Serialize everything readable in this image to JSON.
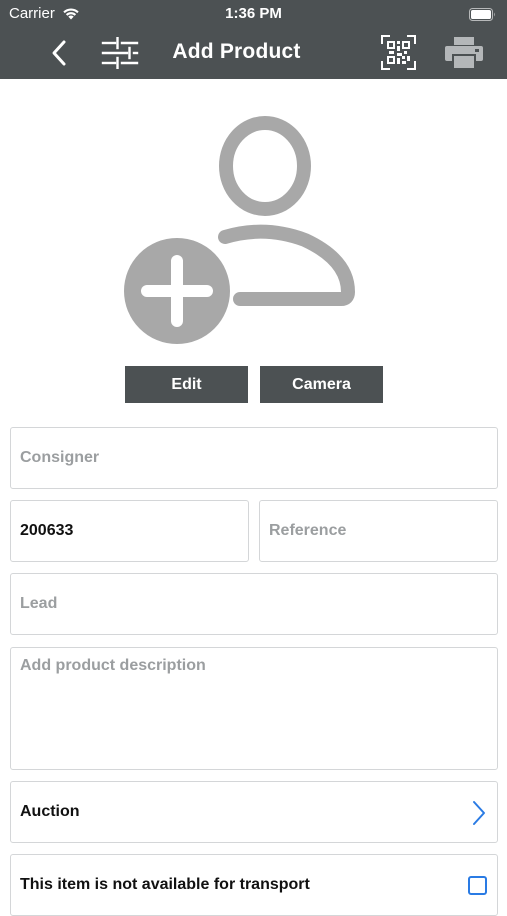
{
  "status_bar": {
    "carrier": "Carrier",
    "time": "1:36 PM"
  },
  "nav": {
    "title": "Add Product",
    "icons": [
      "back-chevron-icon",
      "filter-sliders-icon",
      "qr-code-icon",
      "printer-icon"
    ]
  },
  "photo": {
    "edit_label": "Edit",
    "camera_label": "Camera"
  },
  "form": {
    "consigner_placeholder": "Consigner",
    "number_value": "200633",
    "reference_placeholder": "Reference",
    "lead_placeholder": "Lead",
    "description_placeholder": "Add product description",
    "auction_label": "Auction",
    "transport_label": "This item is not available for transport",
    "transport_checked": false
  },
  "colors": {
    "header_bg": "#4c5153",
    "accent": "#2a7be4",
    "avatar_gray": "#a8a8a8"
  }
}
